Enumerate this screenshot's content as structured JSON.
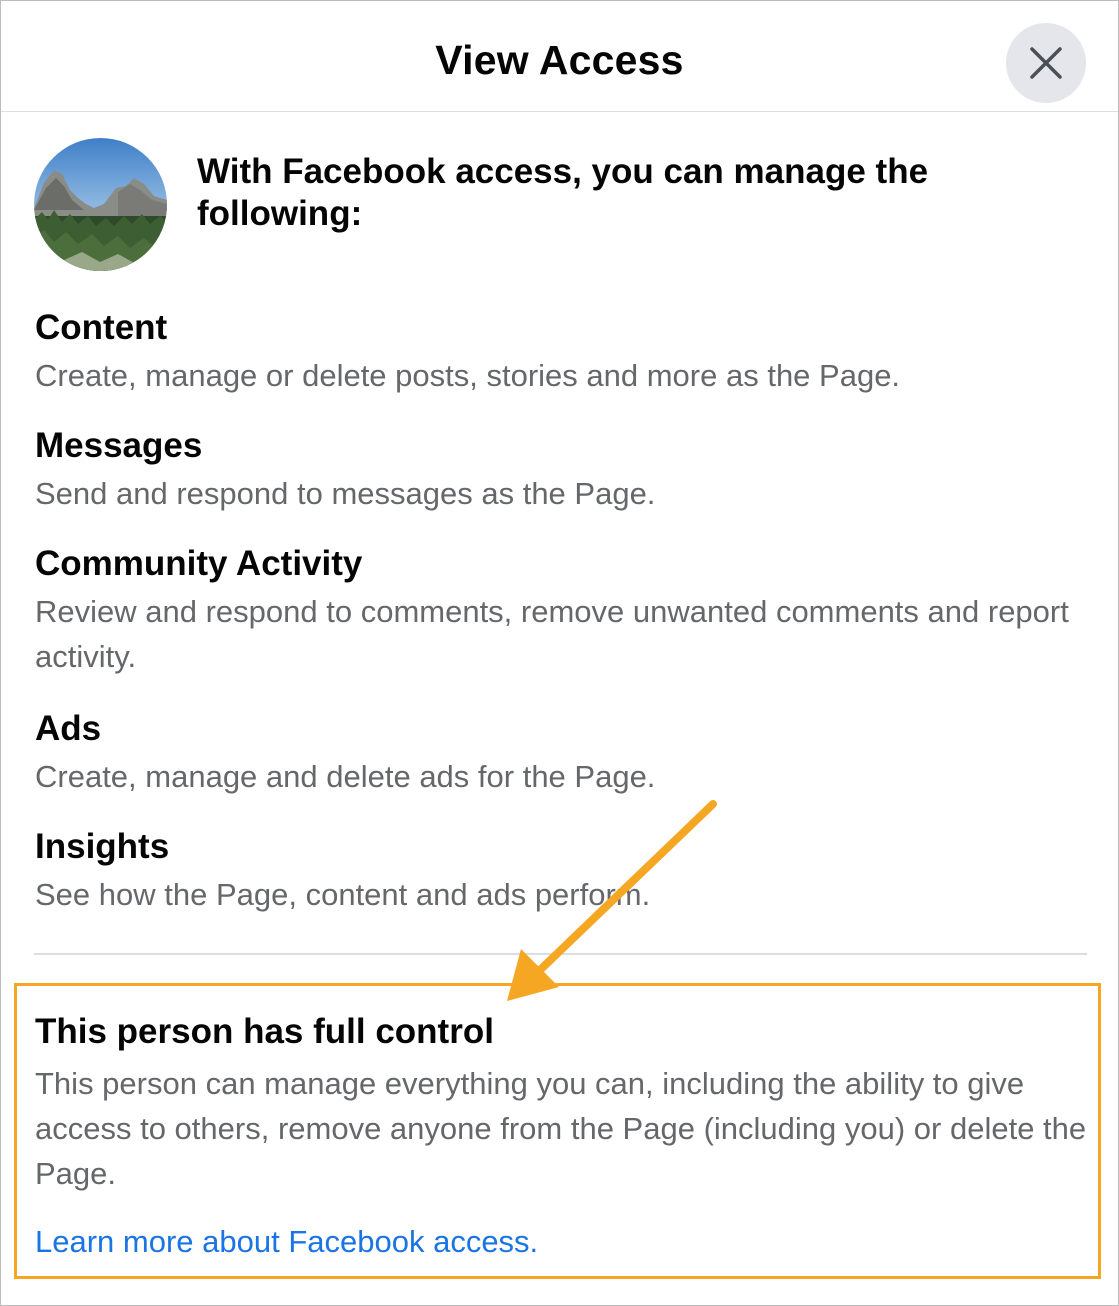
{
  "dialog": {
    "title": "View Access",
    "close_icon": "close-icon"
  },
  "intro": {
    "text": "With Facebook access, you can manage the following:",
    "avatar": "landscape-avatar"
  },
  "permissions": [
    {
      "title": "Content",
      "desc": "Create, manage or delete posts, stories and more as the Page."
    },
    {
      "title": "Messages",
      "desc": "Send and respond to messages as the Page."
    },
    {
      "title": "Community Activity",
      "desc": "Review and respond to comments, remove unwanted comments and report activity."
    },
    {
      "title": "Ads",
      "desc": "Create, manage and delete ads for the Page."
    },
    {
      "title": "Insights",
      "desc": "See how the Page, content and ads perform."
    }
  ],
  "full_control": {
    "title": "This person has full control",
    "desc": "This person can manage everything you can, including the ability to give access to others, remove anyone from the Page (including you) or delete the Page.",
    "link": "Learn more about Facebook access."
  },
  "colors": {
    "highlight": "#f5a623",
    "link": "#1b74e4",
    "secondary_text": "#65676b"
  }
}
